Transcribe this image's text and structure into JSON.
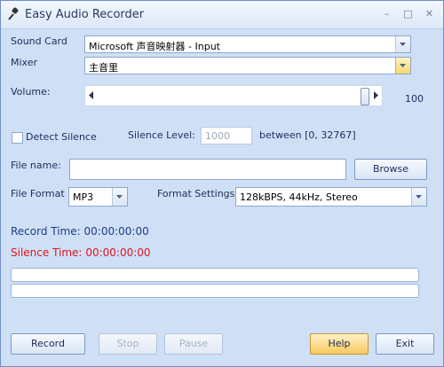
{
  "window": {
    "title": "Easy Audio Recorder",
    "icon": "microphone-icon",
    "minimize": "–",
    "restore": "□",
    "close": "✕"
  },
  "sound_card": {
    "label": "Sound Card",
    "value": "Microsoft 声音映射器 - Input"
  },
  "mixer": {
    "label": "Mixer",
    "value": "主音里"
  },
  "volume": {
    "label": "Volume:",
    "value": "100",
    "level": 100
  },
  "detect_silence": {
    "label": "Detect Silence",
    "checked": false
  },
  "silence_level": {
    "label": "Silence Level:",
    "value": "1000",
    "range": "between [0, 32767]"
  },
  "file_name": {
    "label": "File name:",
    "value": "",
    "browse_label": "Browse"
  },
  "file_format": {
    "label": "File Format",
    "value": "MP3"
  },
  "format_settings": {
    "label": "Format Settings",
    "value": "128kBPS, 44kHz, Stereo"
  },
  "record_time": {
    "label": "Record Time:",
    "value": "00:00:00:00",
    "color": "#1f3a8a"
  },
  "silence_time": {
    "label": "Silence Time:",
    "value": "00:00:00:00",
    "color": "#e0141c"
  },
  "buttons": {
    "record": "Record",
    "stop": "Stop",
    "pause": "Pause",
    "help": "Help",
    "exit": "Exit"
  }
}
